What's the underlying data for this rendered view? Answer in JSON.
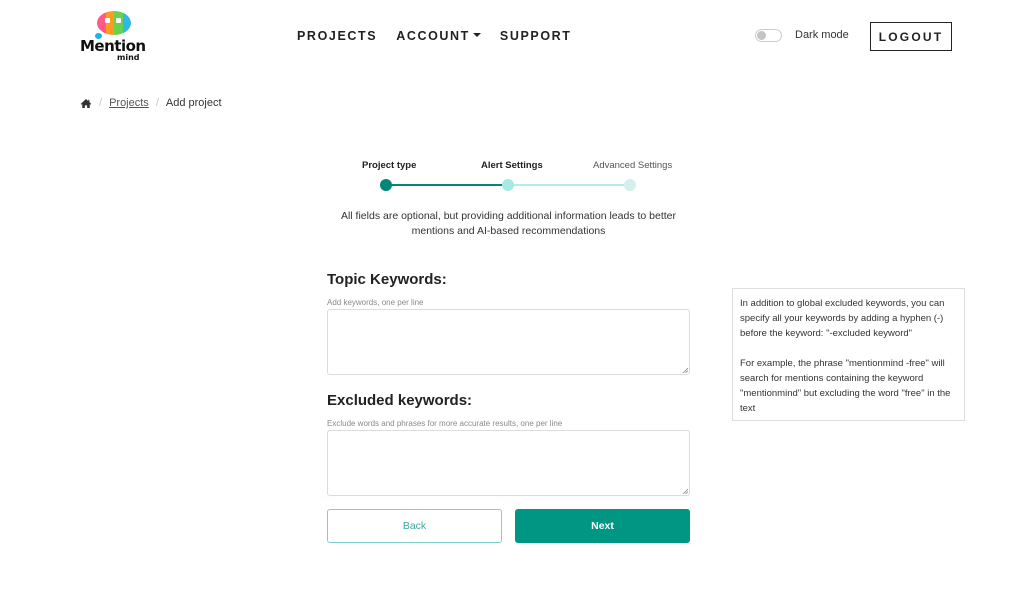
{
  "brand": {
    "name": "Mention",
    "sub": "mind",
    "colors": [
      "#ff5a8a",
      "#ff9a1f",
      "#6bd04a",
      "#2fb9e8"
    ]
  },
  "nav": {
    "items": [
      {
        "label": "PROJECTS",
        "dropdown": false
      },
      {
        "label": "ACCOUNT",
        "dropdown": true
      },
      {
        "label": "SUPPORT",
        "dropdown": false
      }
    ]
  },
  "header": {
    "dark_mode_label": "Dark mode",
    "dark_mode_on": false,
    "logout_label": "LOGOUT"
  },
  "breadcrumb": {
    "home_icon": "home-icon",
    "items": [
      {
        "label": "Projects",
        "link": true
      },
      {
        "label": "Add project",
        "link": false
      }
    ]
  },
  "stepper": {
    "steps": [
      {
        "label": "Project type",
        "state": "completed"
      },
      {
        "label": "Alert Settings",
        "state": "current"
      },
      {
        "label": "Advanced Settings",
        "state": "upcoming"
      }
    ],
    "colors": {
      "completed": "#00877a",
      "current": "#a7e9e3",
      "upcoming": "#d5efec"
    }
  },
  "intro": "All fields are optional, but providing additional information leads to better mentions and AI-based recommendations",
  "form": {
    "topic": {
      "title": "Topic Keywords:",
      "hint": "Add keywords, one per line",
      "value": ""
    },
    "excluded": {
      "title": "Excluded keywords:",
      "hint": "Exclude words and phrases for more accurate results, one per line",
      "value": ""
    },
    "back_label": "Back",
    "next_label": "Next",
    "accent": "#009684"
  },
  "info": {
    "p1": "In addition to global excluded keywords, you can specify all your keywords by adding a hyphen (-) before the keyword: \"-excluded keyword\"",
    "p2": "For example, the phrase \"mentionmind -free\" will search for mentions containing the keyword \"mentionmind\" but excluding the word \"free\" in the text"
  }
}
